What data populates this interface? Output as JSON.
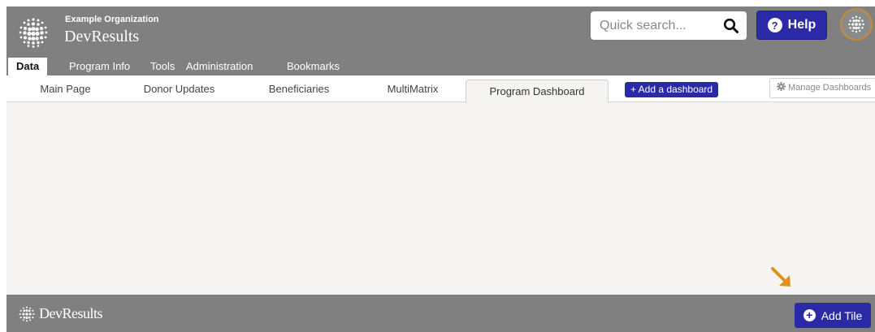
{
  "header": {
    "org_name": "Example Organization",
    "app_name": "DevResults",
    "search_placeholder": "Quick search...",
    "help_label": "Help",
    "logo_icon": "globe-dots-icon",
    "avatar_icon": "globe-dots-icon"
  },
  "main_nav": {
    "tabs": [
      {
        "label": "Data",
        "active": true
      },
      {
        "label": "Program Info"
      },
      {
        "label": "Tools"
      },
      {
        "label": "Administration"
      },
      {
        "label": "Bookmarks"
      }
    ]
  },
  "sub_nav": {
    "tabs": [
      {
        "label": "Main Page"
      },
      {
        "label": "Donor Updates"
      },
      {
        "label": "Beneficiaries"
      },
      {
        "label": "MultiMatrix"
      },
      {
        "label": "Program Dashboard",
        "active": true
      }
    ],
    "add_dashboard_label": "+ Add a dashboard",
    "manage_dashboards_label": "Manage Dashboards"
  },
  "footer": {
    "brand": "DevResults",
    "add_tile_label": "Add Tile"
  },
  "colors": {
    "header_gray": "#808080",
    "accent_blue": "#2a2aa6",
    "annotation_arrow": "#e0911c",
    "content_bg": "#f5f4f2"
  }
}
